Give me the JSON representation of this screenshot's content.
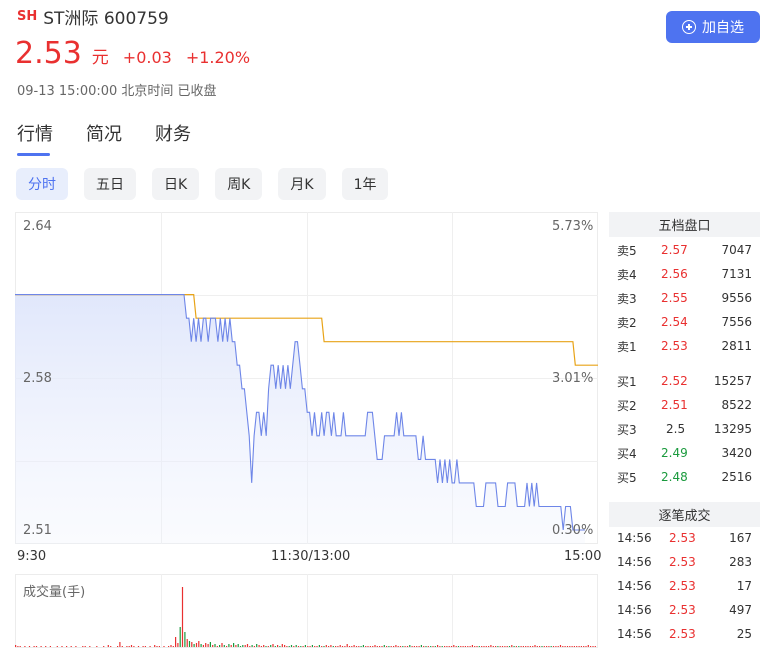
{
  "header": {
    "exchange": "SH",
    "name": "ST洲际 600759",
    "price": "2.53",
    "unit": "元",
    "change": "+0.03",
    "change_pct": "+1.20%",
    "status": "09-13 15:00:00 北京时间 已收盘",
    "add_button": "加自选"
  },
  "tabs": [
    "行情",
    "简况",
    "财务"
  ],
  "periods": [
    "分时",
    "五日",
    "日K",
    "周K",
    "月K",
    "1年"
  ],
  "colors": {
    "up": "#e93030",
    "down": "#1a9a3d",
    "accent": "#4e73f0",
    "avg": "#e8a317",
    "price_line": "#6e86e8"
  },
  "chart_data": {
    "type": "line",
    "y_left_ticks": [
      "2.64",
      "2.58",
      "2.51"
    ],
    "y_right_ticks": [
      "5.73%",
      "3.01%",
      "0.30%"
    ],
    "x_ticks": [
      "9:30",
      "11:30/13:00",
      "15:00"
    ],
    "ylim": [
      2.51,
      2.64
    ],
    "price": [
      2.61,
      2.61,
      2.61,
      2.61,
      2.61,
      2.61,
      2.61,
      2.61,
      2.61,
      2.61,
      2.61,
      2.61,
      2.61,
      2.61,
      2.61,
      2.61,
      2.61,
      2.61,
      2.61,
      2.61,
      2.61,
      2.61,
      2.61,
      2.61,
      2.61,
      2.61,
      2.61,
      2.61,
      2.61,
      2.61,
      2.61,
      2.61,
      2.61,
      2.61,
      2.61,
      2.61,
      2.61,
      2.61,
      2.61,
      2.61,
      2.61,
      2.61,
      2.61,
      2.61,
      2.61,
      2.61,
      2.61,
      2.61,
      2.61,
      2.61,
      2.61,
      2.61,
      2.61,
      2.61,
      2.61,
      2.61,
      2.61,
      2.61,
      2.61,
      2.61,
      2.61,
      2.61,
      2.61,
      2.61,
      2.61,
      2.61,
      2.61,
      2.61,
      2.61,
      2.61,
      2.61,
      2.6,
      2.6,
      2.59,
      2.6,
      2.59,
      2.6,
      2.59,
      2.6,
      2.6,
      2.59,
      2.6,
      2.6,
      2.6,
      2.59,
      2.6,
      2.59,
      2.6,
      2.59,
      2.6,
      2.59,
      2.59,
      2.58,
      2.58,
      2.57,
      2.57,
      2.56,
      2.55,
      2.53,
      2.55,
      2.56,
      2.56,
      2.55,
      2.56,
      2.55,
      2.57,
      2.58,
      2.58,
      2.57,
      2.58,
      2.57,
      2.58,
      2.57,
      2.58,
      2.57,
      2.58,
      2.59,
      2.59,
      2.58,
      2.57,
      2.57,
      2.56,
      2.56,
      2.55,
      2.56,
      2.55,
      2.55,
      2.56,
      2.55,
      2.56,
      2.56,
      2.55,
      2.56,
      2.55,
      2.55,
      2.55,
      2.56,
      2.55,
      2.55,
      2.55,
      2.55,
      2.55,
      2.55,
      2.55,
      2.55,
      2.55,
      2.56,
      2.56,
      2.56,
      2.55,
      2.54,
      2.54,
      2.54,
      2.55,
      2.55,
      2.55,
      2.55,
      2.55,
      2.56,
      2.55,
      2.56,
      2.55,
      2.55,
      2.55,
      2.55,
      2.55,
      2.55,
      2.54,
      2.54,
      2.55,
      2.54,
      2.54,
      2.54,
      2.54,
      2.54,
      2.53,
      2.54,
      2.53,
      2.54,
      2.53,
      2.54,
      2.53,
      2.53,
      2.54,
      2.53,
      2.53,
      2.53,
      2.53,
      2.53,
      2.53,
      2.53,
      2.52,
      2.52,
      2.52,
      2.52,
      2.53,
      2.53,
      2.53,
      2.53,
      2.53,
      2.52,
      2.52,
      2.52,
      2.52,
      2.53,
      2.53,
      2.53,
      2.53,
      2.52,
      2.52,
      2.52,
      2.52,
      2.53,
      2.52,
      2.53,
      2.52,
      2.53,
      2.52,
      2.52,
      2.52,
      2.52,
      2.52,
      2.52,
      2.52,
      2.52,
      2.52,
      2.52,
      2.51,
      2.52,
      2.52,
      2.52,
      2.51,
      2.51,
      2.51,
      2.51,
      2.51,
      2.51
    ],
    "avg": [
      2.61,
      2.61,
      2.61,
      2.61,
      2.61,
      2.61,
      2.61,
      2.61,
      2.61,
      2.61,
      2.61,
      2.61,
      2.61,
      2.61,
      2.61,
      2.61,
      2.61,
      2.61,
      2.61,
      2.61,
      2.61,
      2.61,
      2.61,
      2.61,
      2.61,
      2.61,
      2.61,
      2.61,
      2.61,
      2.61,
      2.61,
      2.61,
      2.61,
      2.61,
      2.61,
      2.61,
      2.61,
      2.61,
      2.61,
      2.61,
      2.61,
      2.61,
      2.61,
      2.61,
      2.61,
      2.61,
      2.61,
      2.61,
      2.61,
      2.61,
      2.61,
      2.61,
      2.61,
      2.61,
      2.61,
      2.61,
      2.61,
      2.61,
      2.61,
      2.61,
      2.61,
      2.61,
      2.61,
      2.61,
      2.61,
      2.61,
      2.61,
      2.61,
      2.61,
      2.61,
      2.61,
      2.61,
      2.61,
      2.61,
      2.61,
      2.6,
      2.6,
      2.6,
      2.6,
      2.6,
      2.6,
      2.6,
      2.6,
      2.6,
      2.6,
      2.6,
      2.6,
      2.6,
      2.6,
      2.6,
      2.6,
      2.6,
      2.6,
      2.6,
      2.6,
      2.6,
      2.6,
      2.6,
      2.6,
      2.6,
      2.6,
      2.6,
      2.6,
      2.6,
      2.6,
      2.6,
      2.6,
      2.6,
      2.6,
      2.6,
      2.6,
      2.6,
      2.6,
      2.6,
      2.6,
      2.6,
      2.6,
      2.6,
      2.6,
      2.6,
      2.6,
      2.6,
      2.6,
      2.6,
      2.6,
      2.6,
      2.6,
      2.6,
      2.59,
      2.59,
      2.59,
      2.59,
      2.59,
      2.59,
      2.59,
      2.59,
      2.59,
      2.59,
      2.59,
      2.59,
      2.59,
      2.59,
      2.59,
      2.59,
      2.59,
      2.59,
      2.59,
      2.59,
      2.59,
      2.59,
      2.59,
      2.59,
      2.59,
      2.59,
      2.59,
      2.59,
      2.59,
      2.59,
      2.59,
      2.59,
      2.59,
      2.59,
      2.59,
      2.59,
      2.59,
      2.59,
      2.59,
      2.59,
      2.59,
      2.59,
      2.59,
      2.59,
      2.59,
      2.59,
      2.59,
      2.59,
      2.59,
      2.59,
      2.59,
      2.59,
      2.59,
      2.59,
      2.59,
      2.59,
      2.59,
      2.59,
      2.59,
      2.59,
      2.59,
      2.59,
      2.59,
      2.59,
      2.59,
      2.59,
      2.59,
      2.59,
      2.59,
      2.59,
      2.59,
      2.59,
      2.59,
      2.59,
      2.59,
      2.59,
      2.59,
      2.59,
      2.59,
      2.59,
      2.59,
      2.59,
      2.59,
      2.59,
      2.59,
      2.59,
      2.59,
      2.59,
      2.59,
      2.59,
      2.59,
      2.59,
      2.59,
      2.59,
      2.59,
      2.59,
      2.59,
      2.59,
      2.59,
      2.59,
      2.59,
      2.59,
      2.59,
      2.59,
      2.58,
      2.58,
      2.58,
      2.58,
      2.58,
      2.58,
      2.58,
      2.58,
      2.58,
      2.58,
      2.58
    ],
    "volume_label": "成交量(手)",
    "volume": [
      2,
      1,
      1,
      0,
      1,
      0,
      1,
      0,
      1,
      1,
      0,
      1,
      0,
      1,
      0,
      1,
      0,
      0,
      1,
      0,
      1,
      0,
      1,
      0,
      1,
      0,
      1,
      0,
      0,
      1,
      1,
      0,
      1,
      0,
      0,
      1,
      0,
      0,
      1,
      0,
      2,
      1,
      0,
      0,
      1,
      5,
      1,
      0,
      1,
      1,
      2,
      1,
      0,
      1,
      0,
      1,
      1,
      0,
      1,
      0,
      2,
      1,
      1,
      0,
      1,
      0,
      1,
      2,
      1,
      10,
      4,
      20,
      60,
      15,
      8,
      6,
      5,
      3,
      4,
      6,
      3,
      2,
      4,
      3,
      5,
      2,
      3,
      1,
      2,
      4,
      2,
      1,
      3,
      2,
      4,
      2,
      3,
      1,
      2,
      2,
      3,
      1,
      2,
      1,
      3,
      2,
      1,
      2,
      1,
      1,
      2,
      3,
      1,
      2,
      1,
      3,
      2,
      1,
      1,
      2,
      1,
      2,
      1,
      1,
      1,
      2,
      1,
      1,
      2,
      1,
      1,
      2,
      1,
      1,
      2,
      1,
      2,
      1,
      1,
      1,
      2,
      1,
      1,
      3,
      1,
      1,
      2,
      1,
      1,
      1,
      2,
      1,
      1,
      1,
      1,
      2,
      1,
      1,
      1,
      2,
      1,
      1,
      1,
      1,
      2,
      1,
      1,
      1,
      1,
      1,
      2,
      1,
      1,
      1,
      1,
      2,
      1,
      1,
      1,
      1,
      1,
      1,
      2,
      1,
      1,
      1,
      1,
      1,
      1,
      2,
      1,
      1,
      1,
      1,
      1,
      1,
      1,
      2,
      1,
      1,
      1,
      1,
      1,
      1,
      1,
      2,
      1,
      1,
      1,
      1,
      1,
      1,
      1,
      1,
      2,
      1,
      1,
      1,
      1,
      1,
      1,
      1,
      1,
      1,
      2,
      1,
      1,
      1,
      1,
      1,
      1,
      1,
      1,
      1,
      1,
      2,
      1,
      1,
      1,
      1,
      1,
      1,
      1,
      1,
      1,
      1,
      1,
      2,
      1,
      1,
      1
    ]
  },
  "order_book": {
    "title": "五档盘口",
    "asks": [
      {
        "label": "卖5",
        "price": "2.57",
        "vol": "7047"
      },
      {
        "label": "卖4",
        "price": "2.56",
        "vol": "7131"
      },
      {
        "label": "卖3",
        "price": "2.55",
        "vol": "9556"
      },
      {
        "label": "卖2",
        "price": "2.54",
        "vol": "7556"
      },
      {
        "label": "卖1",
        "price": "2.53",
        "vol": "2811"
      }
    ],
    "bids": [
      {
        "label": "买1",
        "price": "2.52",
        "vol": "15257",
        "color": "red"
      },
      {
        "label": "买2",
        "price": "2.51",
        "vol": "8522",
        "color": "red"
      },
      {
        "label": "买3",
        "price": "2.5",
        "vol": "13295",
        "color": "gray"
      },
      {
        "label": "买4",
        "price": "2.49",
        "vol": "3420",
        "color": "green"
      },
      {
        "label": "买5",
        "price": "2.48",
        "vol": "2516",
        "color": "green"
      }
    ]
  },
  "trades": {
    "title": "逐笔成交",
    "rows": [
      {
        "time": "14:56",
        "price": "2.53",
        "vol": "167"
      },
      {
        "time": "14:56",
        "price": "2.53",
        "vol": "283"
      },
      {
        "time": "14:56",
        "price": "2.53",
        "vol": "17"
      },
      {
        "time": "14:56",
        "price": "2.53",
        "vol": "497"
      },
      {
        "time": "14:56",
        "price": "2.53",
        "vol": "25"
      }
    ]
  }
}
